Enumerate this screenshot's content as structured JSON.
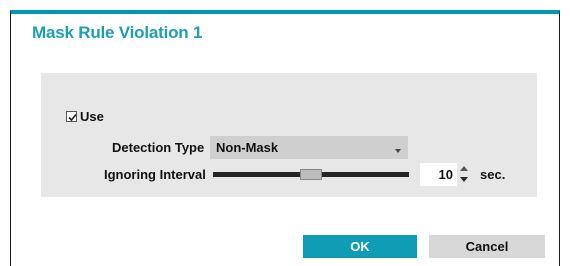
{
  "dialog": {
    "title": "Mask Rule Violation 1"
  },
  "use": {
    "label": "Use",
    "checked": true
  },
  "detection_type": {
    "label": "Detection Type",
    "value": "Non-Mask"
  },
  "ignoring_interval": {
    "label": "Ignoring Interval",
    "value": "10",
    "unit": "sec.",
    "slider_fraction": 0.5
  },
  "buttons": {
    "ok": "OK",
    "cancel": "Cancel"
  },
  "colors": {
    "accent": "#0f9cb5",
    "title": "#1c9fb6",
    "panel": "#e7e7e7"
  }
}
